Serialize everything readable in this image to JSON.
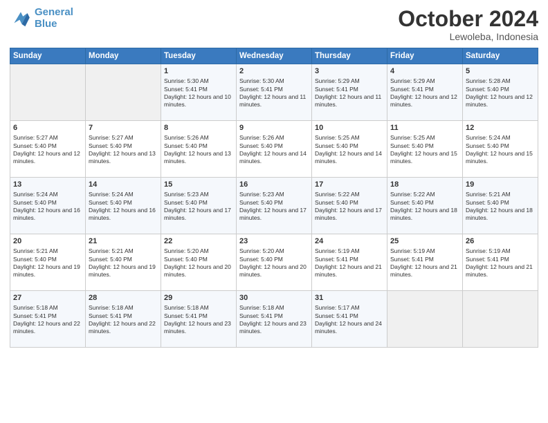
{
  "header": {
    "logo_line1": "General",
    "logo_line2": "Blue",
    "month": "October 2024",
    "location": "Lewoleba, Indonesia"
  },
  "days_of_week": [
    "Sunday",
    "Monday",
    "Tuesday",
    "Wednesday",
    "Thursday",
    "Friday",
    "Saturday"
  ],
  "weeks": [
    [
      {
        "day": "",
        "info": ""
      },
      {
        "day": "",
        "info": ""
      },
      {
        "day": "1",
        "info": "Sunrise: 5:30 AM\nSunset: 5:41 PM\nDaylight: 12 hours and 10 minutes."
      },
      {
        "day": "2",
        "info": "Sunrise: 5:30 AM\nSunset: 5:41 PM\nDaylight: 12 hours and 11 minutes."
      },
      {
        "day": "3",
        "info": "Sunrise: 5:29 AM\nSunset: 5:41 PM\nDaylight: 12 hours and 11 minutes."
      },
      {
        "day": "4",
        "info": "Sunrise: 5:29 AM\nSunset: 5:41 PM\nDaylight: 12 hours and 12 minutes."
      },
      {
        "day": "5",
        "info": "Sunrise: 5:28 AM\nSunset: 5:40 PM\nDaylight: 12 hours and 12 minutes."
      }
    ],
    [
      {
        "day": "6",
        "info": "Sunrise: 5:27 AM\nSunset: 5:40 PM\nDaylight: 12 hours and 12 minutes."
      },
      {
        "day": "7",
        "info": "Sunrise: 5:27 AM\nSunset: 5:40 PM\nDaylight: 12 hours and 13 minutes."
      },
      {
        "day": "8",
        "info": "Sunrise: 5:26 AM\nSunset: 5:40 PM\nDaylight: 12 hours and 13 minutes."
      },
      {
        "day": "9",
        "info": "Sunrise: 5:26 AM\nSunset: 5:40 PM\nDaylight: 12 hours and 14 minutes."
      },
      {
        "day": "10",
        "info": "Sunrise: 5:25 AM\nSunset: 5:40 PM\nDaylight: 12 hours and 14 minutes."
      },
      {
        "day": "11",
        "info": "Sunrise: 5:25 AM\nSunset: 5:40 PM\nDaylight: 12 hours and 15 minutes."
      },
      {
        "day": "12",
        "info": "Sunrise: 5:24 AM\nSunset: 5:40 PM\nDaylight: 12 hours and 15 minutes."
      }
    ],
    [
      {
        "day": "13",
        "info": "Sunrise: 5:24 AM\nSunset: 5:40 PM\nDaylight: 12 hours and 16 minutes."
      },
      {
        "day": "14",
        "info": "Sunrise: 5:24 AM\nSunset: 5:40 PM\nDaylight: 12 hours and 16 minutes."
      },
      {
        "day": "15",
        "info": "Sunrise: 5:23 AM\nSunset: 5:40 PM\nDaylight: 12 hours and 17 minutes."
      },
      {
        "day": "16",
        "info": "Sunrise: 5:23 AM\nSunset: 5:40 PM\nDaylight: 12 hours and 17 minutes."
      },
      {
        "day": "17",
        "info": "Sunrise: 5:22 AM\nSunset: 5:40 PM\nDaylight: 12 hours and 17 minutes."
      },
      {
        "day": "18",
        "info": "Sunrise: 5:22 AM\nSunset: 5:40 PM\nDaylight: 12 hours and 18 minutes."
      },
      {
        "day": "19",
        "info": "Sunrise: 5:21 AM\nSunset: 5:40 PM\nDaylight: 12 hours and 18 minutes."
      }
    ],
    [
      {
        "day": "20",
        "info": "Sunrise: 5:21 AM\nSunset: 5:40 PM\nDaylight: 12 hours and 19 minutes."
      },
      {
        "day": "21",
        "info": "Sunrise: 5:21 AM\nSunset: 5:40 PM\nDaylight: 12 hours and 19 minutes."
      },
      {
        "day": "22",
        "info": "Sunrise: 5:20 AM\nSunset: 5:40 PM\nDaylight: 12 hours and 20 minutes."
      },
      {
        "day": "23",
        "info": "Sunrise: 5:20 AM\nSunset: 5:40 PM\nDaylight: 12 hours and 20 minutes."
      },
      {
        "day": "24",
        "info": "Sunrise: 5:19 AM\nSunset: 5:41 PM\nDaylight: 12 hours and 21 minutes."
      },
      {
        "day": "25",
        "info": "Sunrise: 5:19 AM\nSunset: 5:41 PM\nDaylight: 12 hours and 21 minutes."
      },
      {
        "day": "26",
        "info": "Sunrise: 5:19 AM\nSunset: 5:41 PM\nDaylight: 12 hours and 21 minutes."
      }
    ],
    [
      {
        "day": "27",
        "info": "Sunrise: 5:18 AM\nSunset: 5:41 PM\nDaylight: 12 hours and 22 minutes."
      },
      {
        "day": "28",
        "info": "Sunrise: 5:18 AM\nSunset: 5:41 PM\nDaylight: 12 hours and 22 minutes."
      },
      {
        "day": "29",
        "info": "Sunrise: 5:18 AM\nSunset: 5:41 PM\nDaylight: 12 hours and 23 minutes."
      },
      {
        "day": "30",
        "info": "Sunrise: 5:18 AM\nSunset: 5:41 PM\nDaylight: 12 hours and 23 minutes."
      },
      {
        "day": "31",
        "info": "Sunrise: 5:17 AM\nSunset: 5:41 PM\nDaylight: 12 hours and 24 minutes."
      },
      {
        "day": "",
        "info": ""
      },
      {
        "day": "",
        "info": ""
      }
    ]
  ]
}
